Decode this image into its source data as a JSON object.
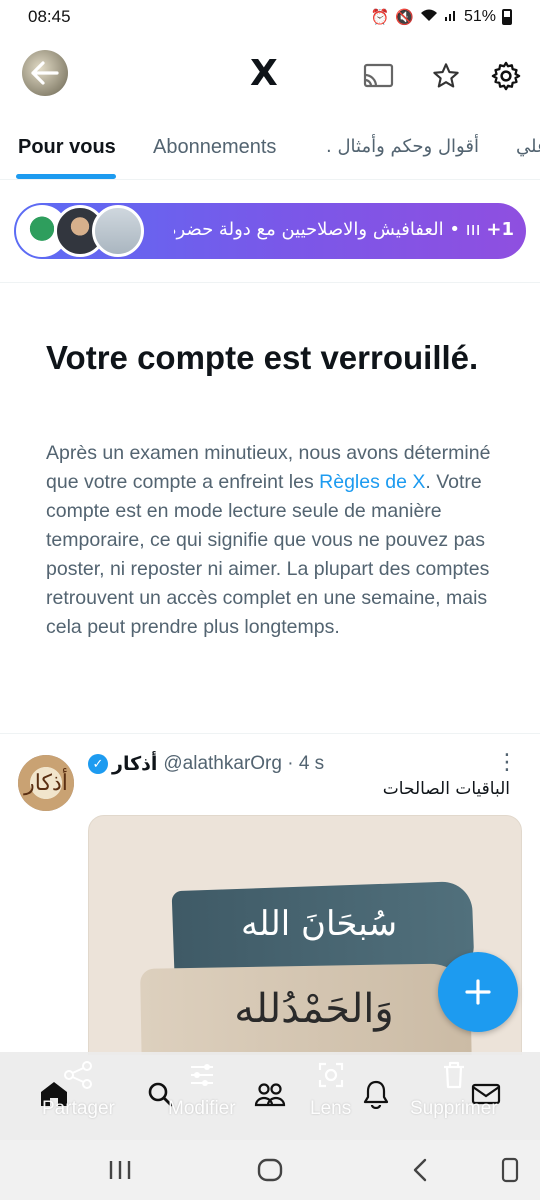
{
  "status_bar": {
    "time": "08:45",
    "battery": "51%"
  },
  "header": {
    "logo": "X"
  },
  "tabs": [
    {
      "label": "Pour vous"
    },
    {
      "label": "Abonnements"
    },
    {
      "label": "أقوال وحكم وأمثال ."
    },
    {
      "label": "علي"
    }
  ],
  "spaces_pill": {
    "count": "+1",
    "title": "العفافيش والاصلاحيين مع دولة حضرم..."
  },
  "lock_notice": {
    "title": "Votre compte est verrouillé.",
    "body_before": "Après un examen minutieux, nous avons déterminé que votre compte a enfreint les ",
    "rules_link": "Règles de X",
    "body_after": ". Votre compte est en mode lecture seule de manière temporaire, ce qui signifie que vous ne pouvez pas poster, ni reposter ni aimer. La plupart des comptes retrouvent un accès complet en une semaine, mais cela peut prendre plus longtemps."
  },
  "tweet": {
    "name": "أذكار",
    "handle": "@alathkarOrg",
    "time": "· 4 s",
    "text": "الباقيات الصالحات",
    "media_line1": "سُبحَانَ الله",
    "media_line2": "وَالحَمْدُلله",
    "avatar_text": "أذكار"
  },
  "share_sheet": {
    "share": "Partager",
    "edit": "Modifier",
    "lens": "Lens",
    "delete": "Supprimer"
  },
  "icons": {
    "back": "back-arrow-icon",
    "cast": "cast-icon",
    "star": "star-icon",
    "settings": "gear-icon",
    "home": "home-icon",
    "search": "search-icon",
    "communities": "people-icon",
    "notifications": "bell-icon",
    "messages": "mail-icon"
  },
  "colors": {
    "accent": "#1d9bf0",
    "pill_start": "#5b6cf4",
    "pill_end": "#8f4fe0"
  }
}
